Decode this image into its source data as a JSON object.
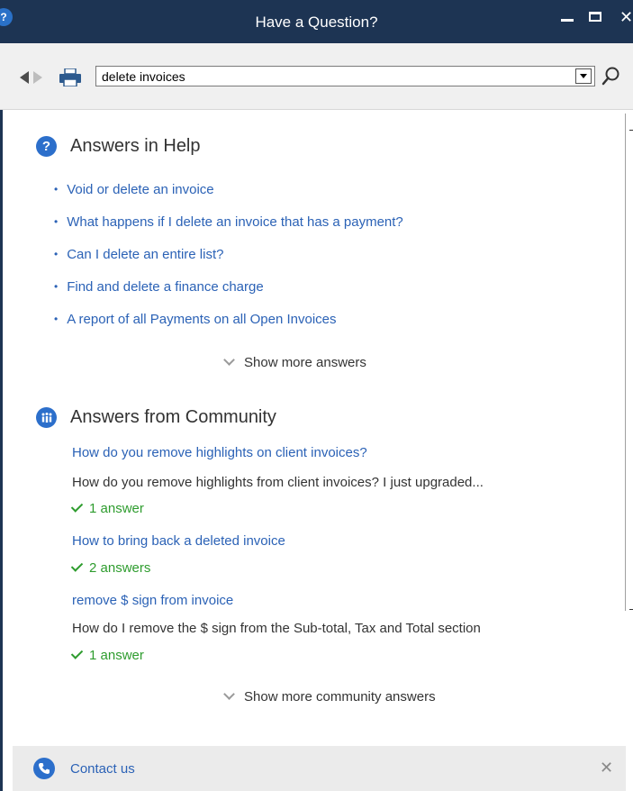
{
  "window": {
    "title": "Have a Question?",
    "logo_glyph": "?",
    "close_glyph": "✕",
    "accent_color": "#1d3453"
  },
  "toolbar": {
    "search_value": "delete invoices",
    "icons": [
      "back-arrow-icon",
      "forward-arrow-icon",
      "printer-icon",
      "dropdown-icon",
      "search-icon"
    ]
  },
  "help": {
    "title": "Answers in Help",
    "icon_glyph": "?",
    "items": [
      "Void or delete an invoice",
      "What happens if I delete an invoice that has a payment?",
      "Can I delete an entire list?",
      "Find and delete a finance charge",
      "A report of all Payments on all Open Invoices"
    ],
    "bullet": "•",
    "show_more": "Show more answers"
  },
  "community": {
    "title": "Answers from Community",
    "icon_glyph": "i",
    "items": [
      {
        "question": "How do you remove highlights on client invoices?",
        "snippet": "How do you remove highlights from client invoices? I just upgraded...",
        "answers": "1 answer"
      },
      {
        "question": "How to bring back a deleted invoice",
        "snippet": "",
        "answers": "2 answers"
      },
      {
        "question": "remove $ sign from invoice",
        "snippet": "How do I remove the $ sign from the Sub-total, Tax and Total section",
        "answers": "1 answer"
      }
    ],
    "show_more": "Show more community answers"
  },
  "footer": {
    "contact": "Contact us",
    "close_glyph": "✕"
  },
  "colors": {
    "link": "#2b62b6",
    "answer_green": "#2e9c2e",
    "icon_blue": "#2c6fcb"
  }
}
